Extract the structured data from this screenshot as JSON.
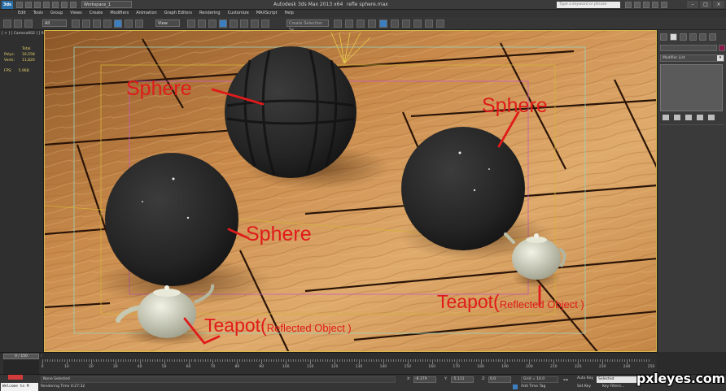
{
  "titlebar": {
    "logo": "3ds",
    "workspace": "Workspace_1",
    "app_title": "Autodesk 3ds Max  2013 x64",
    "file_name": "refle sphere.max",
    "search_placeholder": "Type a keyword or phrase",
    "min": "–",
    "max": "□",
    "close": "×"
  },
  "menu": [
    "Edit",
    "Tools",
    "Group",
    "Views",
    "Create",
    "Modifiers",
    "Animation",
    "Graph Editors",
    "Rendering",
    "Customize",
    "MAXScript",
    "Help"
  ],
  "toolbar": {
    "filter": "All",
    "ref_coord": "View",
    "named_sel": "Create Selection Se"
  },
  "viewport": {
    "label": "[ + ] [ Camera002 ] [ Realistic ]",
    "stats": {
      "total_label": "Total",
      "polys_label": "Polys:",
      "polys_value": "16,558",
      "verts_label": "Verts:",
      "verts_value": "11,820",
      "fps_label": "FPS:",
      "fps_value": "5.968"
    },
    "annotations": {
      "sphere_top": "Sphere",
      "sphere_right": "Sphere",
      "sphere_left": "Sphere",
      "teapot_left_main": "Teapot(",
      "teapot_left_sub": "Reflected Object )",
      "teapot_right_main": "Teapot(",
      "teapot_right_sub": "Reflected Object )"
    },
    "colors": {
      "annotation": "#e01b1b",
      "wood_light": "#d9a566",
      "wood_dark": "#a8692f",
      "sphere": "#262626",
      "teapot": "#d6d8c4"
    }
  },
  "command_panel": {
    "modifier_list": "Modifier List",
    "arrow": "▾"
  },
  "timeline": {
    "position": "0 / 150",
    "arrow": "›",
    "ticks": [
      "0",
      "10",
      "20",
      "30",
      "40",
      "50",
      "60",
      "70",
      "80",
      "90",
      "100",
      "110",
      "120",
      "130",
      "140",
      "150",
      "160",
      "170",
      "180",
      "190",
      "200",
      "210",
      "220",
      "230",
      "240",
      "250"
    ]
  },
  "status": {
    "maxscript": "Welcome to M",
    "selection": "None Selected",
    "render_time": "Rendering Time  0:27:32",
    "x_label": "X:",
    "x_value": "-8.379",
    "y_label": "Y:",
    "y_value": "-5.111",
    "z_label": "Z:",
    "z_value": "0.0",
    "grid": "Grid = 10.0",
    "add_time_tag": "Add Time Tag",
    "auto_key": "Auto Key",
    "set_key": "Set Key",
    "selected": "Selected",
    "key_filters": "Key Filters...",
    "key_icon": "⊶"
  },
  "watermark": "pxleyes.com"
}
